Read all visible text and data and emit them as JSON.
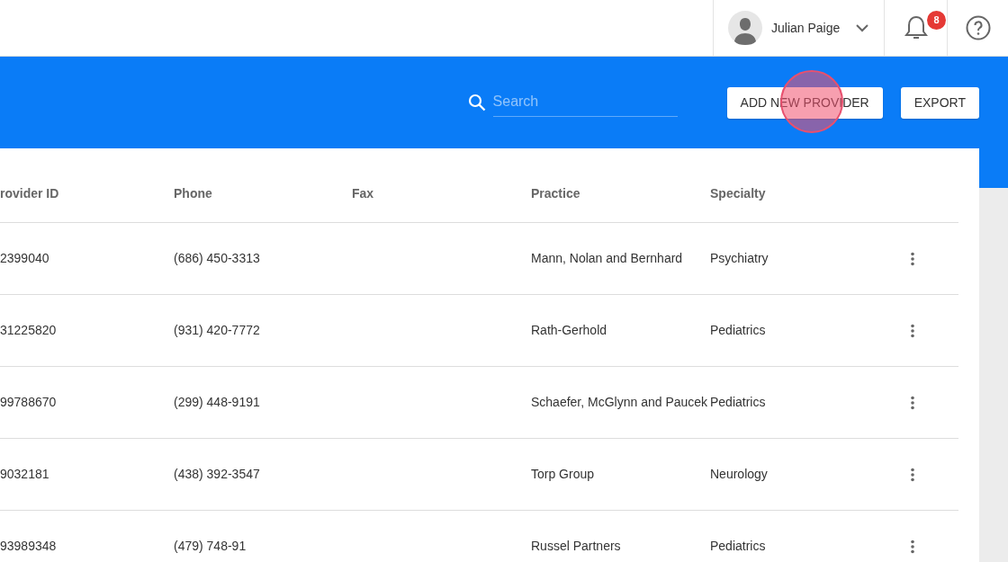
{
  "user_menu": {
    "name": "Julian Paige"
  },
  "notifications": {
    "count": "8"
  },
  "toolbar": {
    "search": {
      "placeholder": "Search"
    },
    "buttons": [
      "ADD NEW PROVIDER",
      "EXPORT"
    ]
  },
  "click_highlight": {
    "on": true
  },
  "table": {
    "columns": [
      "rovider ID",
      "Phone",
      "Fax",
      "Practice",
      "Specialty"
    ],
    "rows": [
      {
        "provider_id": "2399040",
        "phone": "(686) 450-3313",
        "practice": "Mann, Nolan and Bernhard",
        "specialty": "Psychiatry"
      },
      {
        "provider_id": "31225820",
        "phone": "(931) 420-7772",
        "practice": "Rath-Gerhold",
        "specialty": "Pediatrics"
      },
      {
        "provider_id": "99788670",
        "phone": "(299) 448-9191",
        "practice": "Schaefer, McGlynn and Paucek",
        "specialty": "Pediatrics"
      },
      {
        "provider_id": "9032181",
        "phone": "(438) 392-3547",
        "practice": "Torp Group",
        "specialty": "Neurology"
      },
      {
        "provider_id": "93989348",
        "phone": "(479) 748-91",
        "practice": "Russel Partners",
        "specialty": "Pediatrics"
      }
    ]
  }
}
